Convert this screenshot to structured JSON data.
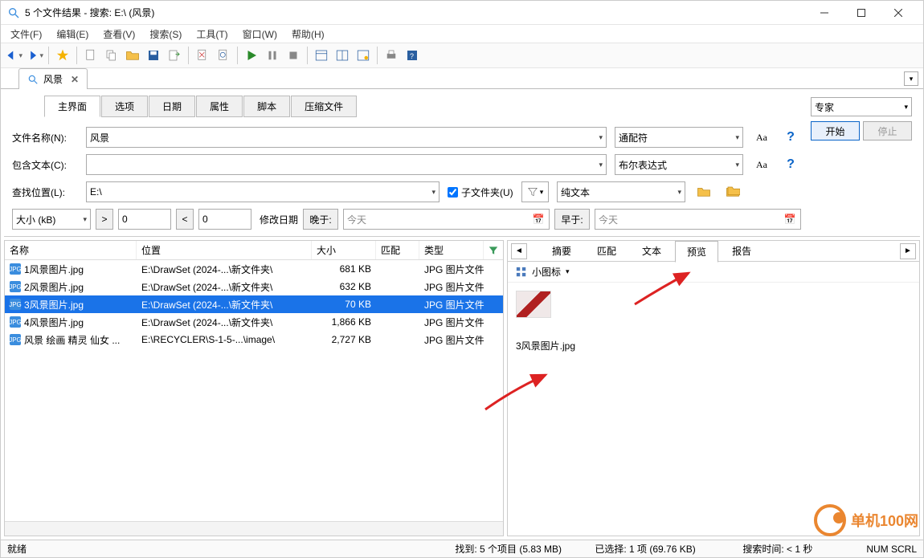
{
  "window": {
    "title": "5 个文件结果 - 搜索: E:\\ (风景)"
  },
  "menu": [
    "文件(F)",
    "编辑(E)",
    "查看(V)",
    "搜索(S)",
    "工具(T)",
    "窗口(W)",
    "帮助(H)"
  ],
  "tab": {
    "label": "风景"
  },
  "inner_tabs": [
    "主界面",
    "选项",
    "日期",
    "属性",
    "脚本",
    "压缩文件"
  ],
  "labels": {
    "filename": "文件名称(N):",
    "contains": "包含文本(C):",
    "lookin": "查找位置(L):",
    "subfolders": "子文件夹(U)",
    "size_unit": "大小 (kB)",
    "mod_date": "修改日期",
    "later": "晚于:",
    "earlier": "早于:",
    "today1": "今天",
    "today2": "今天",
    "expert": "专家",
    "start": "开始",
    "stop": "停止",
    "gt": ">",
    "lt": "<"
  },
  "values": {
    "filename": "风景",
    "contains": "",
    "lookin": "E:\\",
    "mode1": "通配符",
    "mode2": "布尔表达式",
    "mode3": "纯文本",
    "size_from": "0",
    "size_to": "0"
  },
  "font_Aa": "Aa",
  "columns": {
    "name": "名称",
    "loc": "位置",
    "size": "大小",
    "match": "匹配",
    "type": "类型"
  },
  "rows": [
    {
      "name": "1风景图片.jpg",
      "loc": "E:\\DrawSet (2024-...\\新文件夹\\",
      "size": "681 KB",
      "type": "JPG 图片文件",
      "sel": false
    },
    {
      "name": "2风景图片.jpg",
      "loc": "E:\\DrawSet (2024-...\\新文件夹\\",
      "size": "632 KB",
      "type": "JPG 图片文件",
      "sel": false
    },
    {
      "name": "3风景图片.jpg",
      "loc": "E:\\DrawSet (2024-...\\新文件夹\\",
      "size": "70 KB",
      "type": "JPG 图片文件",
      "sel": true
    },
    {
      "name": "4风景图片.jpg",
      "loc": "E:\\DrawSet (2024-...\\新文件夹\\",
      "size": "1,866 KB",
      "type": "JPG 图片文件",
      "sel": false
    },
    {
      "name": "风景 绘画 精灵 仙女 ...",
      "loc": "E:\\RECYCLER\\S-1-5-...\\image\\",
      "size": "2,727 KB",
      "type": "JPG 图片文件",
      "sel": false
    }
  ],
  "preview": {
    "tabs": [
      "摘要",
      "匹配",
      "文本",
      "预览",
      "报告"
    ],
    "active": 3,
    "view_mode": "小图标",
    "thumb_label": "3风景图片.jpg"
  },
  "status": {
    "ready": "就绪",
    "found": "找到: 5 个项目 (5.83 MB)",
    "selected": "已选择: 1 项 (69.76 KB)",
    "time": "搜索时间: < 1 秒",
    "keys": "NUM SCRL"
  },
  "watermark": "单机100网"
}
